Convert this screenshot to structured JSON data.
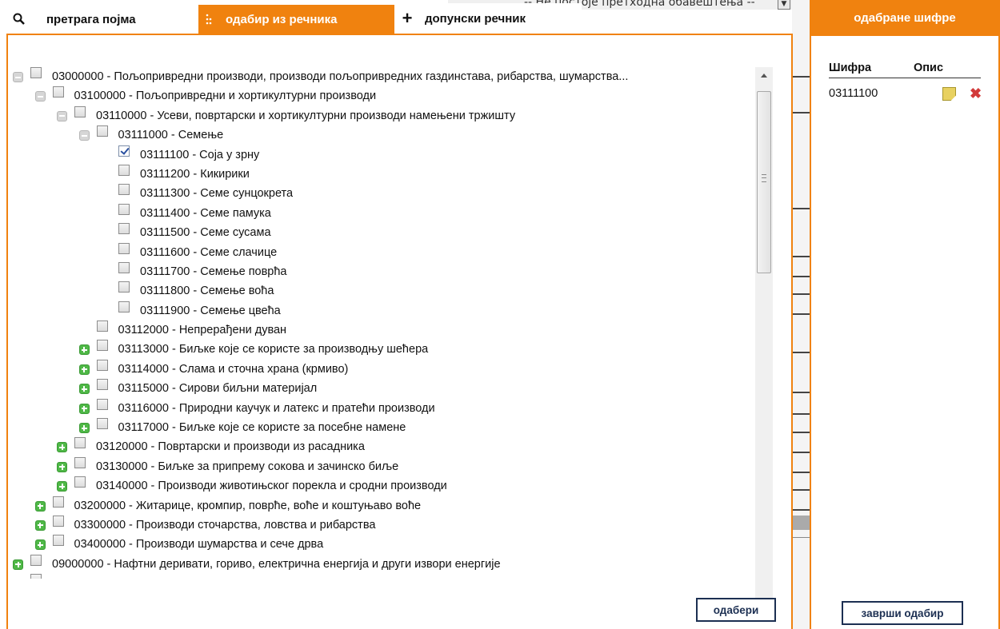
{
  "background": {
    "top_text": "-- Не постоје претходна обавештења --"
  },
  "tabs": [
    {
      "label": "претрага појма",
      "icon": "search-icon",
      "active": false
    },
    {
      "label": "одабир из речника",
      "icon": "tree-dots-icon",
      "active": true
    },
    {
      "label": "допунски речник",
      "icon": "plus-icon",
      "active": false
    }
  ],
  "tree": [
    {
      "level": 0,
      "toggle": "minus",
      "checked": false,
      "label": "03000000 - Пољопривредни производи, производи пољопривредних газдинстава, рибарства, шумарства..."
    },
    {
      "level": 1,
      "toggle": "minus",
      "checked": false,
      "label": "03100000 - Пољопривредни и хортикултурни производи"
    },
    {
      "level": 2,
      "toggle": "minus",
      "checked": false,
      "label": "03110000 - Усеви, повртарски и хортикултурни производи намењени тржишту"
    },
    {
      "level": 3,
      "toggle": "minus",
      "checked": false,
      "label": "03111000 - Семење"
    },
    {
      "level": 4,
      "toggle": "none",
      "checked": true,
      "label": "03111100 - Соја у зрну"
    },
    {
      "level": 4,
      "toggle": "none",
      "checked": false,
      "label": "03111200 - Кикирики"
    },
    {
      "level": 4,
      "toggle": "none",
      "checked": false,
      "label": "03111300 - Семе сунцокрета"
    },
    {
      "level": 4,
      "toggle": "none",
      "checked": false,
      "label": "03111400 - Семе памука"
    },
    {
      "level": 4,
      "toggle": "none",
      "checked": false,
      "label": "03111500 - Семе сусама"
    },
    {
      "level": 4,
      "toggle": "none",
      "checked": false,
      "label": "03111600 - Семе слачице"
    },
    {
      "level": 4,
      "toggle": "none",
      "checked": false,
      "label": "03111700 - Семење поврћа"
    },
    {
      "level": 4,
      "toggle": "none",
      "checked": false,
      "label": "03111800 - Семење воћа"
    },
    {
      "level": 4,
      "toggle": "none",
      "checked": false,
      "label": "03111900 - Семење цвећа"
    },
    {
      "level": 3,
      "toggle": "none",
      "checked": false,
      "label": "03112000 - Непрерађени дуван"
    },
    {
      "level": 3,
      "toggle": "plus",
      "checked": false,
      "label": "03113000 - Биљке које се користе за производњу шећера"
    },
    {
      "level": 3,
      "toggle": "plus",
      "checked": false,
      "label": "03114000 - Слама и сточна храна (крмиво)"
    },
    {
      "level": 3,
      "toggle": "plus",
      "checked": false,
      "label": "03115000 - Сирови биљни материјал"
    },
    {
      "level": 3,
      "toggle": "plus",
      "checked": false,
      "label": "03116000 - Природни каучук и латекс и пратећи производи"
    },
    {
      "level": 3,
      "toggle": "plus",
      "checked": false,
      "label": "03117000 - Биљке које се користе за посебне намене"
    },
    {
      "level": 2,
      "toggle": "plus",
      "checked": false,
      "label": "03120000 - Повртарски и производи из расадника"
    },
    {
      "level": 2,
      "toggle": "plus",
      "checked": false,
      "label": "03130000 - Биљке за припрему сокова и зачинско биље"
    },
    {
      "level": 2,
      "toggle": "plus",
      "checked": false,
      "label": "03140000 - Производи животињског порекла и сродни производи"
    },
    {
      "level": 1,
      "toggle": "plus",
      "checked": false,
      "label": "03200000 - Житарице, кромпир, поврће, воће и коштуњаво воће"
    },
    {
      "level": 1,
      "toggle": "plus",
      "checked": false,
      "label": "03300000 - Производи сточарства, ловства и рибарства"
    },
    {
      "level": 1,
      "toggle": "plus",
      "checked": false,
      "label": "03400000 - Производи шумарства и сече дрва"
    },
    {
      "level": 0,
      "toggle": "plus",
      "checked": false,
      "label": "09000000 - Нафтни деривати, гориво, електрична енергија и други извори енергије"
    }
  ],
  "choose_button": "одабери",
  "right_panel": {
    "header": "одабране шифре",
    "col_code": "Шифра",
    "col_desc": "Опис",
    "selected": [
      {
        "code": "03111100"
      }
    ],
    "finish_button": "заврши одабир"
  },
  "colors": {
    "accent": "#f0820f",
    "button_border": "#1c2f52",
    "expand_green": "#4fb847",
    "remove_red": "#d23a3a"
  }
}
